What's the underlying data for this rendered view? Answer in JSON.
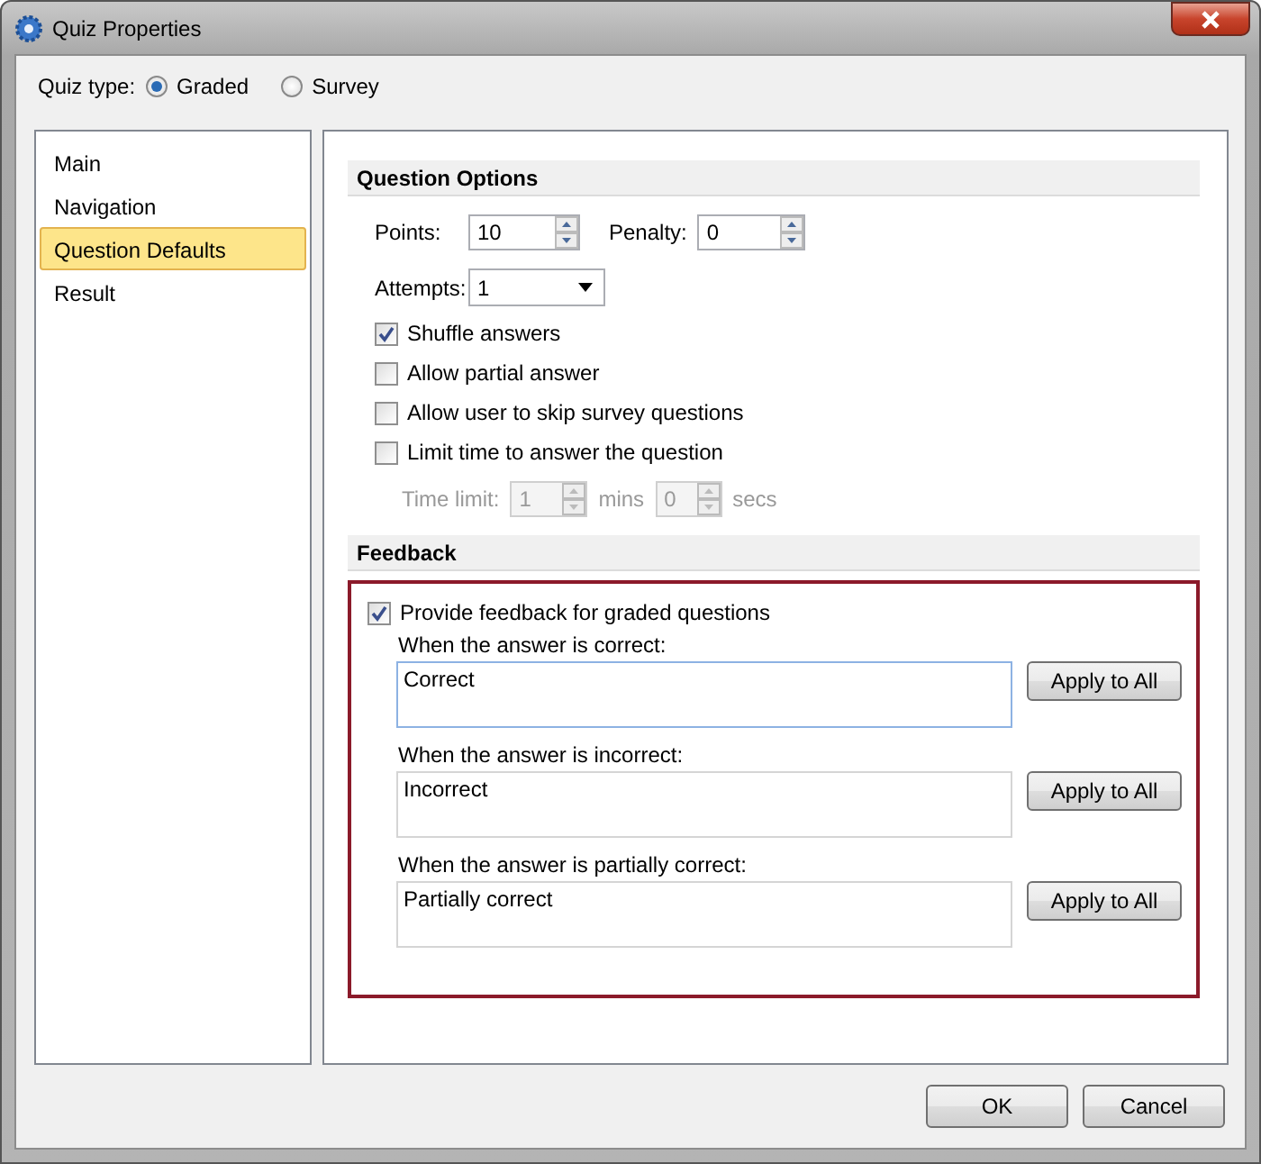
{
  "window": {
    "title": "Quiz Properties"
  },
  "quiz_type": {
    "label": "Quiz type:",
    "options": [
      {
        "label": "Graded",
        "selected": true
      },
      {
        "label": "Survey",
        "selected": false
      }
    ]
  },
  "sidebar": {
    "items": [
      {
        "label": "Main",
        "selected": false
      },
      {
        "label": "Navigation",
        "selected": false
      },
      {
        "label": "Question Defaults",
        "selected": true
      },
      {
        "label": "Result",
        "selected": false
      }
    ]
  },
  "question_options": {
    "title": "Question Options",
    "points": {
      "label": "Points:",
      "value": "10"
    },
    "penalty": {
      "label": "Penalty:",
      "value": "0"
    },
    "attempts": {
      "label": "Attempts:",
      "value": "1"
    },
    "checkboxes": [
      {
        "label": "Shuffle answers",
        "checked": true
      },
      {
        "label": "Allow partial answer",
        "checked": false
      },
      {
        "label": "Allow user to skip survey questions",
        "checked": false
      },
      {
        "label": "Limit time to answer the question",
        "checked": false
      }
    ],
    "time_limit": {
      "label": "Time limit:",
      "disabled": true,
      "minutes": "1",
      "minutes_unit": "mins",
      "seconds": "0",
      "seconds_unit": "secs"
    }
  },
  "feedback": {
    "title": "Feedback",
    "highlighted": true,
    "provide": {
      "label": "Provide feedback for graded questions",
      "checked": true
    },
    "entries": [
      {
        "label": "When the answer is correct:",
        "value": "Correct",
        "focused": true,
        "button": "Apply to All"
      },
      {
        "label": "When the answer is incorrect:",
        "value": "Incorrect",
        "focused": false,
        "button": "Apply to All"
      },
      {
        "label": "When the answer is partially correct:",
        "value": "Partially correct",
        "focused": false,
        "button": "Apply to All"
      }
    ]
  },
  "buttons": [
    {
      "label": "OK"
    },
    {
      "label": "Cancel"
    }
  ]
}
